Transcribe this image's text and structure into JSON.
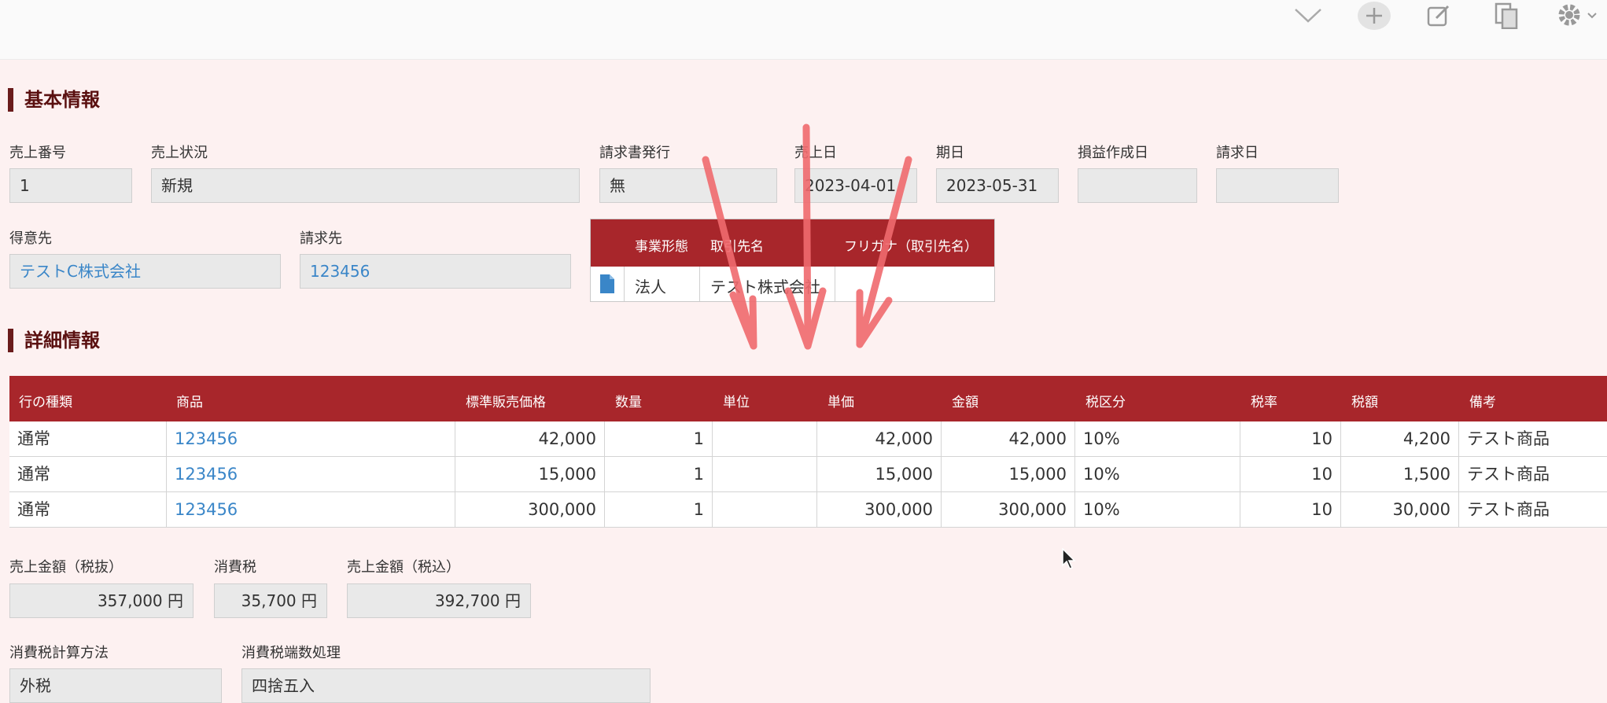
{
  "toolbar": {
    "icons": [
      "chevron-down-icon",
      "plus-icon",
      "edit-icon",
      "copy-icon",
      "gear-icon"
    ]
  },
  "basic": {
    "title": "基本情報",
    "fields": {
      "sales_no": {
        "label": "売上番号",
        "value": "1"
      },
      "sales_status": {
        "label": "売上状況",
        "value": "新規"
      },
      "invoice_issue": {
        "label": "請求書発行",
        "value": "無"
      },
      "sales_date": {
        "label": "売上日",
        "value": "2023-04-01"
      },
      "due_date": {
        "label": "期日",
        "value": "2023-05-31"
      },
      "pl_date": {
        "label": "損益作成日",
        "value": ""
      },
      "billing_date": {
        "label": "請求日",
        "value": ""
      },
      "customer": {
        "label": "得意先",
        "value": "テストC株式会社"
      },
      "bill_to": {
        "label": "請求先",
        "value": "123456"
      }
    },
    "ref_table": {
      "headers": [
        "事業形態",
        "取引先名",
        "フリガナ（取引先名）"
      ],
      "row": {
        "type": "法人",
        "name": "テスト株式会社",
        "kana": ""
      }
    }
  },
  "detail": {
    "title": "詳細情報",
    "headers": [
      "行の種類",
      "商品",
      "標準販売価格",
      "数量",
      "単位",
      "単価",
      "金額",
      "税区分",
      "税率",
      "税額",
      "備考"
    ],
    "rows": [
      {
        "kind": "通常",
        "product": "123456",
        "std_price": "42,000",
        "qty": "1",
        "unit": "",
        "unit_price": "42,000",
        "amount": "42,000",
        "tax_class": "10%",
        "tax_rate": "10",
        "tax": "4,200",
        "note": "テスト商品"
      },
      {
        "kind": "通常",
        "product": "123456",
        "std_price": "15,000",
        "qty": "1",
        "unit": "",
        "unit_price": "15,000",
        "amount": "15,000",
        "tax_class": "10%",
        "tax_rate": "10",
        "tax": "1,500",
        "note": "テスト商品"
      },
      {
        "kind": "通常",
        "product": "123456",
        "std_price": "300,000",
        "qty": "1",
        "unit": "",
        "unit_price": "300,000",
        "amount": "300,000",
        "tax_class": "10%",
        "tax_rate": "10",
        "tax": "30,000",
        "note": "テスト商品"
      }
    ]
  },
  "totals": {
    "subtotal": {
      "label": "売上金額（税抜）",
      "value": "357,000 円"
    },
    "tax": {
      "label": "消費税",
      "value": "35,700 円"
    },
    "total": {
      "label": "売上金額（税込）",
      "value": "392,700 円"
    }
  },
  "tax_settings": {
    "method": {
      "label": "消費税計算方法",
      "value": "外税"
    },
    "rounding": {
      "label": "消費税端数処理",
      "value": "四捨五入"
    }
  },
  "colors": {
    "header": "#a8262b",
    "link": "#3a86c8",
    "arrow": "#f06a6e",
    "title": "#5a1010"
  }
}
